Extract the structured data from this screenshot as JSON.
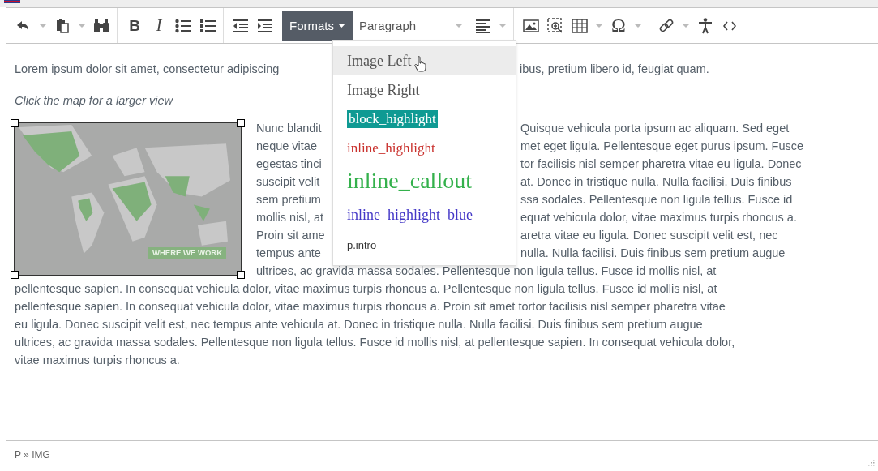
{
  "toolbar": {
    "bold_label": "B",
    "italic_label": "I",
    "formats": {
      "label": "Formats",
      "pressed": true
    },
    "block_format": "Paragraph",
    "special_char": "Ω"
  },
  "formats_menu": {
    "open": true,
    "items": [
      {
        "label": "Image Left",
        "kind": "plain",
        "hovered": true
      },
      {
        "label": "Image Right",
        "kind": "plain",
        "hovered": false
      },
      {
        "label": "block_highlight",
        "kind": "block_highlight",
        "hovered": false
      },
      {
        "label": "inline_highlight",
        "kind": "inline_highlight",
        "hovered": false
      },
      {
        "label": "inline_callout",
        "kind": "callout",
        "hovered": false
      },
      {
        "label": "inline_highlight_blue",
        "kind": "highlight_blue",
        "hovered": false
      },
      {
        "label": "p.intro",
        "kind": "intro",
        "hovered": false
      }
    ]
  },
  "content": {
    "intro": {
      "left": "Lorem ipsum dolor sit amet, consectetur adipiscing",
      "right": "ibus, pretium libero id, feugiat quam."
    },
    "caption": "Click the map for a larger view",
    "image": {
      "label": "WHERE WE WORK",
      "selected": true
    },
    "image_lines": [
      {
        "left": "Nunc blandit",
        "right": "Quisque vehicula porta ipsum ac aliquam. Sed eget"
      },
      {
        "left": "neque vitae",
        "right": "met eget ligula. Pellentesque eget purus ipsum. Fusce"
      },
      {
        "left": "egestas tinci",
        "right": "tor facilisis nisl semper pharetra vitae eu ligula. Donec"
      },
      {
        "left": "suscipit velit",
        "right": "at. Donec in tristique nulla. Nulla facilisi. Duis finibus"
      },
      {
        "left": "sem pretium",
        "right": "ssa sodales. Pellentesque non ligula tellus. Fusce id"
      },
      {
        "left": "mollis nisl, at",
        "right": "equat vehicula dolor, vitae maximus turpis rhoncus a."
      },
      {
        "left": "Proin sit ame",
        "right": "aretra vitae eu ligula. Donec suscipit velit est, nec"
      },
      {
        "left": "tempus ante",
        "right": "nulla. Nulla facilisi. Duis finibus sem pretium augue"
      },
      {
        "text": "ultrices, ac gravida massa sodales. Pellentesque non ligula tellus. Fusce id mollis nisl, at"
      }
    ],
    "lines": [
      "pellentesque sapien. In consequat vehicula dolor, vitae maximus turpis rhoncus a. Pellentesque non ligula tellus. Fusce id mollis nisl, at",
      "pellentesque sapien. In consequat vehicula dolor, vitae maximus turpis rhoncus a.  Proin sit amet tortor facilisis nisl semper pharetra vitae",
      "eu ligula. Donec suscipit velit est, nec tempus ante vehicula at. Donec in tristique nulla. Nulla facilisi. Duis finibus sem pretium augue",
      "ultrices, ac gravida massa sodales. Pellentesque non ligula tellus. Fusce id mollis nisl, at pellentesque sapien. In consequat vehicula dolor,",
      "vitae maximus turpis rhoncus a."
    ]
  },
  "status_bar": {
    "path": "P » IMG"
  }
}
